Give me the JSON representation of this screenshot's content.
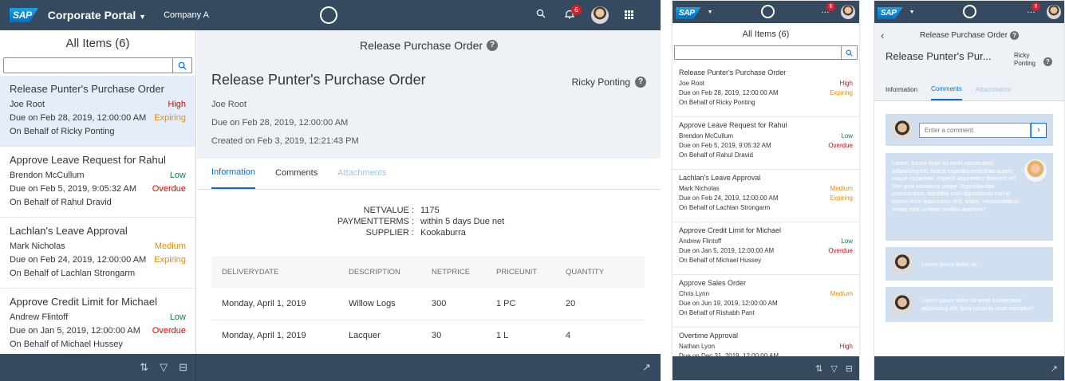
{
  "shell": {
    "logo": "SAP",
    "portal_title": "Corporate Portal",
    "company": "Company A",
    "notification_count": "6"
  },
  "master": {
    "title": "All Items (6)",
    "search_placeholder": "",
    "items": [
      {
        "title": "Release Punter's Purchase Order",
        "person": "Joe Root",
        "priority": "High",
        "due": "Due on Feb 28, 2019, 12:00:00 AM",
        "status": "Expiring",
        "behalf": "On Behalf of Ricky Ponting"
      },
      {
        "title": "Approve Leave Request for Rahul",
        "person": "Brendon McCullum",
        "priority": "Low",
        "due": "Due on Feb 5, 2019, 9:05:32 AM",
        "status": "Overdue",
        "behalf": "On Behalf of Rahul Dravid"
      },
      {
        "title": "Lachlan's Leave Approval",
        "person": "Mark Nicholas",
        "priority": "Medium",
        "due": "Due on Feb 24, 2019, 12:00:00 AM",
        "status": "Expiring",
        "behalf": "On Behalf of Lachlan Strongarm"
      },
      {
        "title": "Approve Credit Limit for Michael",
        "person": "Andrew Flintoff",
        "priority": "Low",
        "due": "Due on Jan 5, 2019, 12:00:00 AM",
        "status": "Overdue",
        "behalf": "On Behalf of Michael Hussey"
      },
      {
        "title": "Approve Sales Order",
        "person": "Chris Lynn",
        "priority": "Medium",
        "due": "Due on Jun 19, 2019, 12:00:00 AM",
        "status": "",
        "behalf": "On Behalf of Rishabh Pant"
      },
      {
        "title": "Overtime Approval",
        "person": "Nathan Lyon",
        "priority": "High",
        "due": "Due on Dec 31, 2019, 12:00:00 AM",
        "status": "",
        "behalf": ""
      }
    ]
  },
  "detail": {
    "header_title": "Release Purchase Order",
    "title": "Release Punter's Purchase Order",
    "title_short": "Release Punter's Pur...",
    "assignee": "Ricky Ponting",
    "assignee_first": "Ricky",
    "assignee_last": "Ponting",
    "created_by": "Joe Root",
    "due": "Due on Feb 28, 2019, 12:00:00 AM",
    "created": "Created on Feb 3, 2019, 12:21:43 PM",
    "tabs": [
      "Information",
      "Comments",
      "Attachments"
    ],
    "fields": [
      {
        "label": "NETVALUE :",
        "value": "1175"
      },
      {
        "label": "PAYMENTTERMS :",
        "value": "within 5 days Due net"
      },
      {
        "label": "SUPPLIER :",
        "value": "Kookaburra"
      }
    ],
    "table_headers": [
      "DELIVERYDATE",
      "DESCRIPTION",
      "NETPRICE",
      "PRICEUNIT",
      "QUANTITY"
    ],
    "table_rows": [
      [
        "Monday, April 1, 2019",
        "Willow Logs",
        "300",
        "1 PC",
        "20"
      ],
      [
        "Monday, April 1, 2019",
        "Lacquer",
        "30",
        "1 L",
        "4"
      ]
    ]
  },
  "comments": {
    "input_placeholder": "Enter a comment",
    "items": [
      {
        "text": "Lorem, ipsum dolor sit amet consectetur adipisicing elit. Natus expedita molestiae autem eaque obcaecati, impedit aspernatur dolorem et? Sint quia possimus saepe. Repudiandae accusantium, expedita cum dignissimos non id earum error aspernatur sed, totam, necessitatibus neque velit veritatis mollitia aperiam?"
      },
      {
        "text": "Lorem ipsum dolor sit."
      },
      {
        "text": "Lorem ipsum dolor sit amet consectetur adipisicing elit. Ipsa corporis amet excepturi!"
      }
    ]
  },
  "colors": {
    "shell": "#354a5f",
    "accent": "#0a6ed1",
    "high": "#e60000",
    "medium": "#e78c07",
    "low": "#107e3e",
    "comment_bg": "#d1e0f0"
  },
  "icons": [
    "search-icon",
    "bell-icon",
    "grid-icon",
    "sort-icon",
    "filter-icon",
    "group-icon",
    "share-icon",
    "help-icon",
    "back-icon",
    "send-icon",
    "chevron-down-icon"
  ]
}
